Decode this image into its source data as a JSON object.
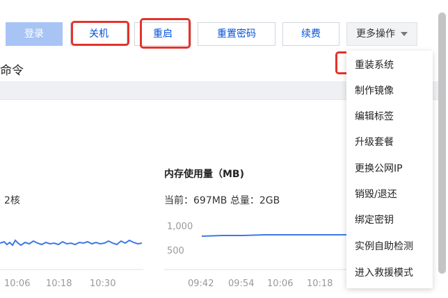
{
  "toolbar": {
    "login": "登录",
    "shutdown": "关机",
    "restart": "重启",
    "reset_password": "重置密码",
    "renew": "续费",
    "more_actions": "更多操作"
  },
  "section_title": "命令",
  "cpu_panel": {
    "value": "2核"
  },
  "mem_panel": {
    "title": "内存使用量（MB)",
    "summary": "当前：697MB 总量：2GB"
  },
  "cpu_axis": {
    "x_ticks": [
      "10:06",
      "10:18",
      "10:30"
    ]
  },
  "mem_axis": {
    "y_ticks": [
      "1,000",
      "500"
    ],
    "x_ticks": [
      "09:42",
      "09:54",
      "10:06",
      "10:18"
    ]
  },
  "menu": {
    "items": [
      "重装系统",
      "制作镜像",
      "编辑标签",
      "升级套餐",
      "更换公网IP",
      "销毁/退还",
      "绑定密钥",
      "实例自助检测",
      "进入救援模式"
    ]
  },
  "colors": {
    "accent": "#0052d9",
    "highlight": "#e4322b",
    "line": "#3b78e7"
  }
}
